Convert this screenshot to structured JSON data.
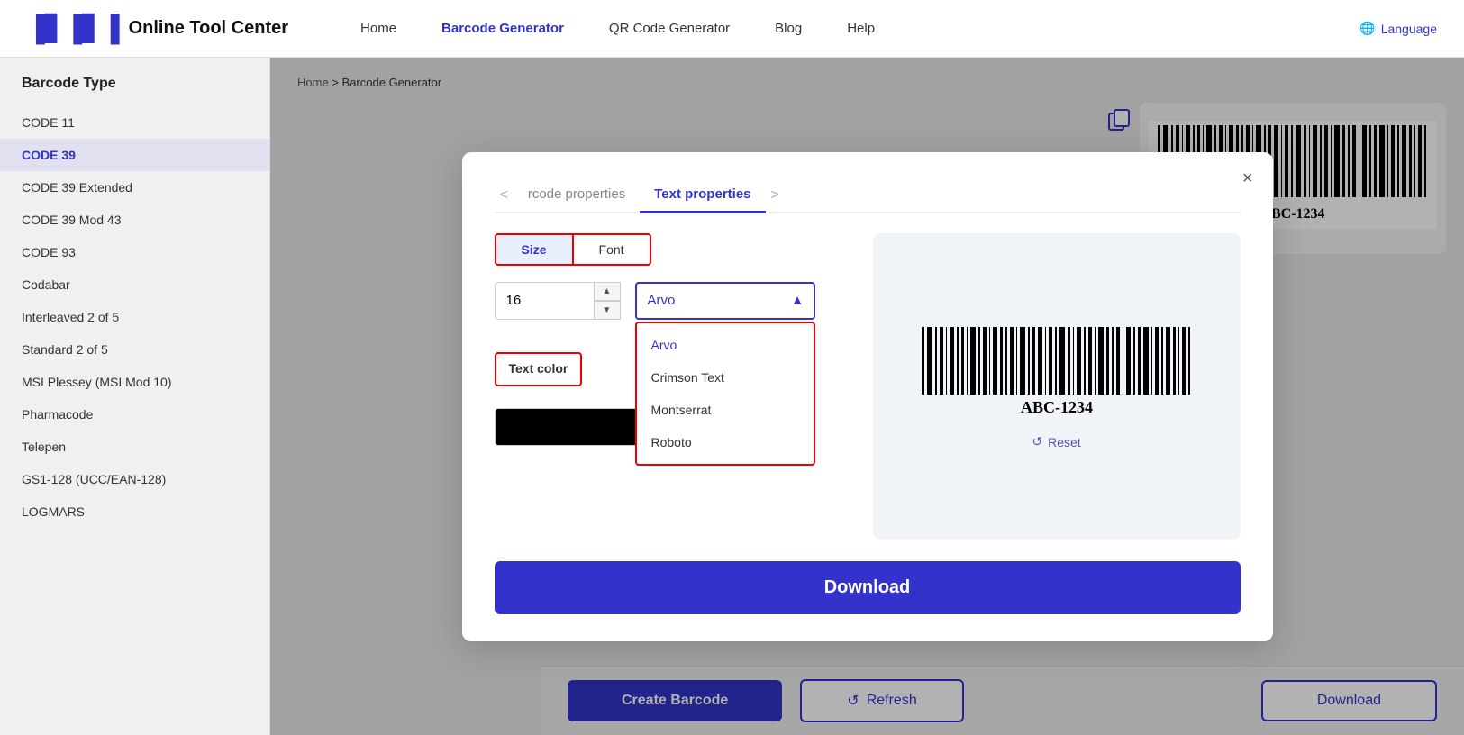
{
  "header": {
    "logo_icon": "▐▌▐▌▐▌",
    "logo_text": "Online Tool Center",
    "nav_items": [
      {
        "label": "Home",
        "active": false
      },
      {
        "label": "Barcode Generator",
        "active": true
      },
      {
        "label": "QR Code Generator",
        "active": false
      },
      {
        "label": "Blog",
        "active": false
      },
      {
        "label": "Help",
        "active": false
      }
    ],
    "language_label": "Language"
  },
  "sidebar": {
    "title": "Barcode Type",
    "items": [
      {
        "label": "CODE 11",
        "active": false
      },
      {
        "label": "CODE 39",
        "active": true
      },
      {
        "label": "CODE 39 Extended",
        "active": false
      },
      {
        "label": "CODE 39 Mod 43",
        "active": false
      },
      {
        "label": "CODE 93",
        "active": false
      },
      {
        "label": "Codabar",
        "active": false
      },
      {
        "label": "Interleaved 2 of 5",
        "active": false
      },
      {
        "label": "Standard 2 of 5",
        "active": false
      },
      {
        "label": "MSI Plessey (MSI Mod 10)",
        "active": false
      },
      {
        "label": "Pharmacode",
        "active": false
      },
      {
        "label": "Telepen",
        "active": false
      },
      {
        "label": "GS1-128 (UCC/EAN-128)",
        "active": false
      },
      {
        "label": "LOGMARS",
        "active": false
      }
    ]
  },
  "breadcrumb": {
    "home": "Home",
    "separator": ">",
    "current": "Barcode Generator"
  },
  "bottom_toolbar": {
    "create_label": "Create Barcode",
    "refresh_label": "Refresh",
    "download_label": "Download"
  },
  "modal": {
    "tabs": [
      {
        "label": "rcode properties",
        "active": false
      },
      {
        "label": "Text properties",
        "active": true
      }
    ],
    "prev_arrow": "<",
    "next_arrow": ">",
    "close_label": "×",
    "prop_tabs": [
      {
        "label": "Size",
        "active": true
      },
      {
        "label": "Font",
        "active": false
      }
    ],
    "size_value": "16",
    "font_selected": "Arvo",
    "font_options": [
      {
        "label": "Arvo",
        "selected": true
      },
      {
        "label": "Crimson Text",
        "selected": false
      },
      {
        "label": "Montserrat",
        "selected": false
      },
      {
        "label": "Roboto",
        "selected": false
      }
    ],
    "text_color_label": "Text color",
    "color_swatch_color": "#000000",
    "reset_label": "Reset",
    "download_label": "Download",
    "barcode_value": "ABC-1234"
  }
}
